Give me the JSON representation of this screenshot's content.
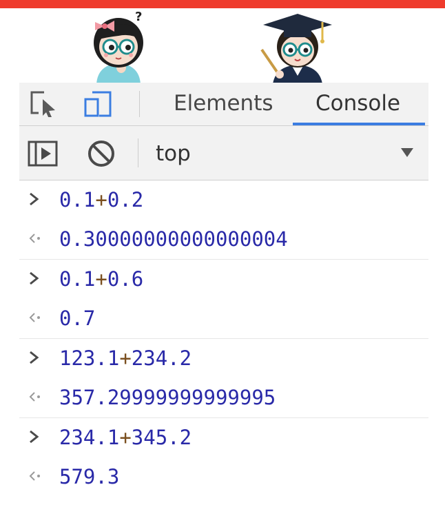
{
  "illustrations": {
    "left": "confused-girl-with-glasses",
    "right": "graduate-with-glasses-and-cap"
  },
  "devtools": {
    "tabs": [
      {
        "label": "Elements",
        "active": false
      },
      {
        "label": "Console",
        "active": true
      }
    ],
    "toolbar": {
      "context": "top"
    },
    "accent_color": "#3b7de1"
  },
  "console": {
    "entries": [
      {
        "input_left": "0.1",
        "op": "+",
        "input_right": "0.2",
        "output": "0.30000000000000004"
      },
      {
        "input_left": "0.1",
        "op": "+",
        "input_right": "0.6",
        "output": "0.7"
      },
      {
        "input_left": "123.1",
        "op": "+",
        "input_right": "234.2",
        "output": "357.29999999999995"
      },
      {
        "input_left": "234.1",
        "op": "+",
        "input_right": "345.2",
        "output": "579.3"
      }
    ]
  }
}
